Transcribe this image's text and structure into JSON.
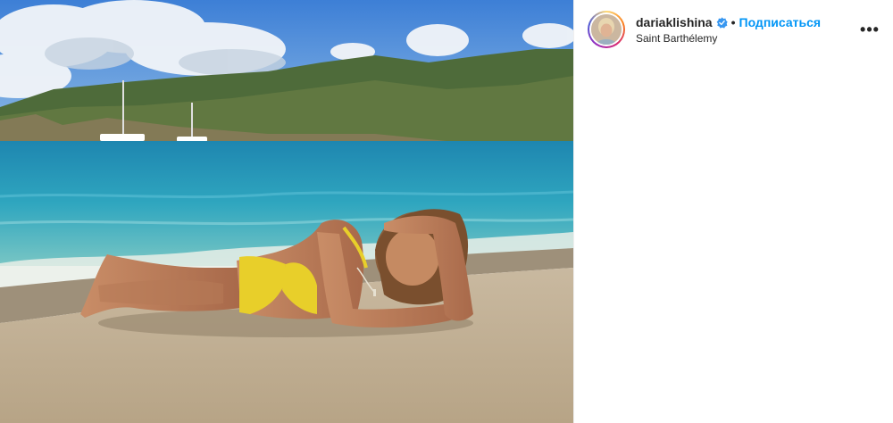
{
  "post": {
    "username": "dariaklishina",
    "separator": "•",
    "follow_label": "Подписаться",
    "location": "Saint Barthélemy",
    "more_label": "•••"
  },
  "icons": {
    "verified": "verified-badge-icon",
    "more": "more-options-icon"
  },
  "colors": {
    "follow_blue": "#0095f6",
    "verified_blue": "#3897f0",
    "text_dark": "#262626"
  }
}
